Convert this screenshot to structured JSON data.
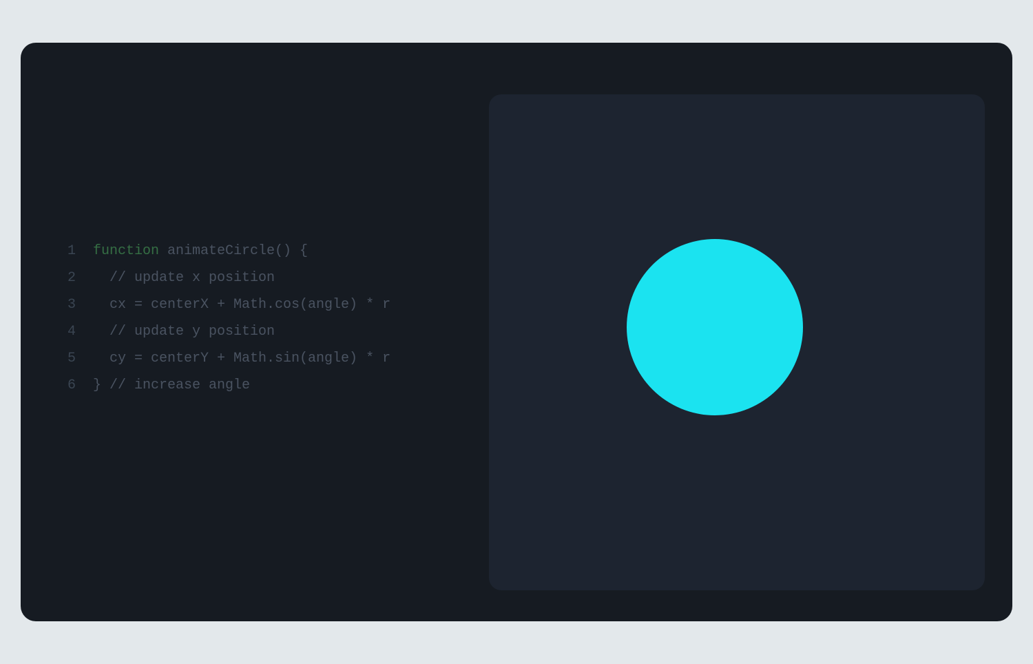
{
  "code": {
    "lines": [
      {
        "num": "1"
      },
      {
        "num": "2"
      },
      {
        "num": "3"
      },
      {
        "num": "4"
      },
      {
        "num": "5"
      },
      {
        "num": "6"
      }
    ],
    "l1_keyword": "function",
    "l1_rest": " animateCircle() {",
    "l2": "  // update x position",
    "l3": "  cx = centerX + Math.cos(angle) * r",
    "l4": "  // update y position",
    "l5": "  cy = centerY + Math.sin(angle) * r",
    "l6": "} // increase angle"
  },
  "preview": {
    "circle_color": "#1be3f0"
  }
}
